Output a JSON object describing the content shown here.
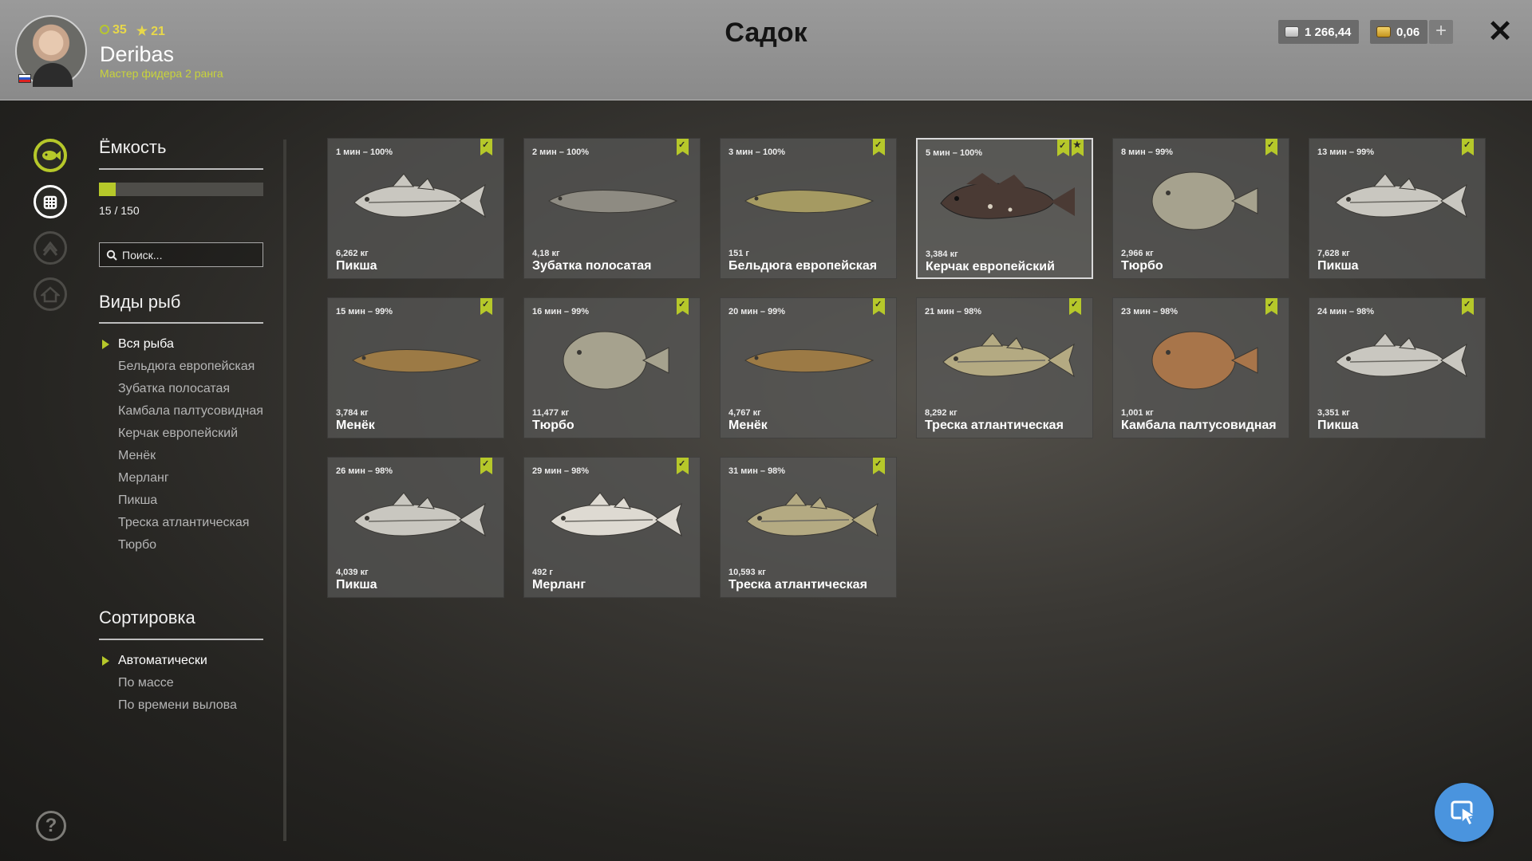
{
  "header": {
    "title": "Садок",
    "player": {
      "level": "35",
      "stars": "21",
      "username": "Deribas",
      "rank": "Мастер фидера 2 ранга"
    },
    "currency": {
      "silver": "1 266,44",
      "gold": "0,06",
      "add_label": "+"
    },
    "close_label": "✕"
  },
  "sidebar": {
    "capacity": {
      "heading": "Ёмкость",
      "text": "15 / 150",
      "fill_fraction": 0.1
    },
    "search": {
      "placeholder": "Поиск..."
    },
    "species": {
      "heading": "Виды рыб",
      "items": [
        "Вся рыба",
        "Бельдюга европейская",
        "Зубатка полосатая",
        "Камбала палтусовидная",
        "Керчак европейский",
        "Менёк",
        "Мерланг",
        "Пикша",
        "Треска атлантическая",
        "Тюрбо"
      ],
      "active_index": 0
    },
    "sort": {
      "heading": "Сортировка",
      "items": [
        "Автоматически",
        "По массе",
        "По времени вылова"
      ],
      "active_index": 0
    },
    "help_label": "?"
  },
  "catch": [
    {
      "time": "1 мин – 100%",
      "weight": "6,262 кг",
      "name": "Пикша",
      "fish": "haddock",
      "color": "#c9c7c0"
    },
    {
      "time": "2 мин – 100%",
      "weight": "4,18 кг",
      "name": "Зубатка полосатая",
      "fish": "wolffish",
      "color": "#8e8b82"
    },
    {
      "time": "3 мин – 100%",
      "weight": "151 г",
      "name": "Бельдюга европейская",
      "fish": "eelpout",
      "color": "#a59a62"
    },
    {
      "time": "5 мин – 100%",
      "weight": "3,384 кг",
      "name": "Керчак европейский",
      "fish": "scorpion",
      "color": "#4a3a34",
      "selected": true,
      "starred": true
    },
    {
      "time": "8 мин – 99%",
      "weight": "2,966 кг",
      "name": "Тюрбо",
      "fish": "flatfish",
      "color": "#a6a28e"
    },
    {
      "time": "13 мин – 99%",
      "weight": "7,628 кг",
      "name": "Пикша",
      "fish": "haddock",
      "color": "#c9c7c0"
    },
    {
      "time": "15 мин – 99%",
      "weight": "3,784 кг",
      "name": "Менёк",
      "fish": "tusk",
      "color": "#9c7a45"
    },
    {
      "time": "16 мин – 99%",
      "weight": "11,477 кг",
      "name": "Тюрбо",
      "fish": "flatfish",
      "color": "#a6a28e"
    },
    {
      "time": "20 мин – 99%",
      "weight": "4,767 кг",
      "name": "Менёк",
      "fish": "tusk",
      "color": "#9c7a45"
    },
    {
      "time": "21 мин – 98%",
      "weight": "8,292 кг",
      "name": "Треска атлантическая",
      "fish": "cod",
      "color": "#b4aa82"
    },
    {
      "time": "23 мин – 98%",
      "weight": "1,001 кг",
      "name": "Камбала палтусовидная",
      "fish": "plaice",
      "color": "#a8754a"
    },
    {
      "time": "24 мин – 98%",
      "weight": "3,351 кг",
      "name": "Пикша",
      "fish": "haddock",
      "color": "#c9c7c0"
    },
    {
      "time": "26 мин – 98%",
      "weight": "4,039 кг",
      "name": "Пикша",
      "fish": "haddock",
      "color": "#c9c7c0"
    },
    {
      "time": "29 мин – 98%",
      "weight": "492 г",
      "name": "Мерланг",
      "fish": "whiting",
      "color": "#dedad2"
    },
    {
      "time": "31 мин – 98%",
      "weight": "10,593 кг",
      "name": "Треска атлантическая",
      "fish": "cod",
      "color": "#b4aa82"
    }
  ],
  "colors": {
    "accent": "#b6c82a",
    "header_bg": "#8f8f8f",
    "card_bg": "#585856",
    "action_button": "#4a94de"
  },
  "icons": {
    "rail": [
      "fish-icon",
      "keepnet-icon",
      "rank-icon",
      "home-icon"
    ],
    "action": "cursor-icon"
  }
}
